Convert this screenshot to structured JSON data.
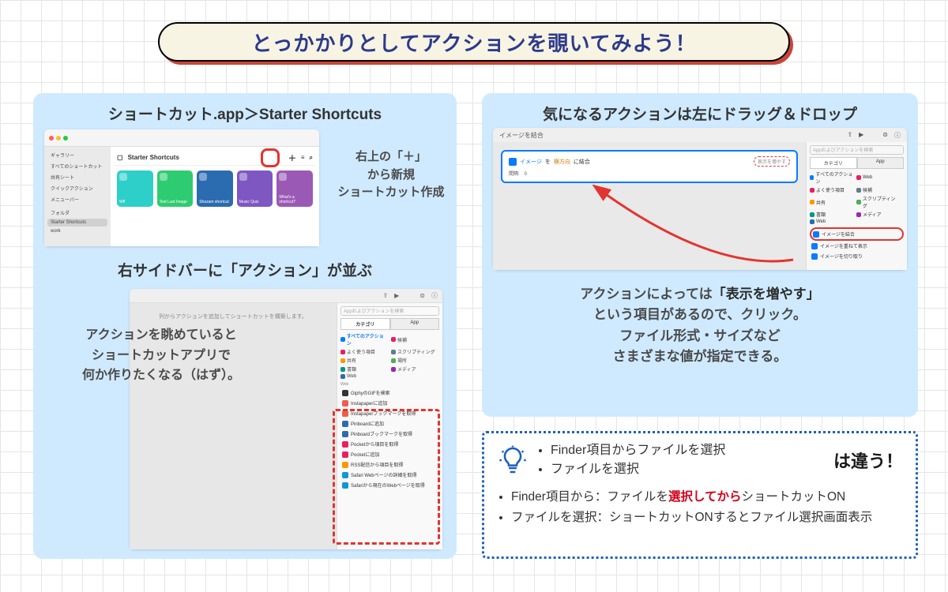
{
  "title": "とっかかりとしてアクションを覗いてみよう！",
  "left": {
    "heading": "ショートカット.app＞Starter Shortcuts",
    "starter": {
      "window_title": "Starter Shortcuts",
      "sidebar_group1": "ギャラリー",
      "sidebar_items": [
        "すべてのショートカット",
        "共有シート",
        "クイックアクション",
        "メニューバー"
      ],
      "sidebar_group2": "フォルダ",
      "sidebar_folders": [
        "Starter Shortcuts",
        "work"
      ],
      "tiles": [
        "Wfl",
        "Text Last Image",
        "Shazam shortcut",
        "Music Quiz",
        "What's a shortcut?"
      ]
    },
    "note1_l1": "右上の「＋」",
    "note1_l2": "から新規",
    "note1_l3": "ショートカット作成",
    "subheading2": "右サイドバーに「アクション」が並ぶ",
    "note2_l1": "アクションを眺めていると",
    "note2_l2": "ショートカットアプリで",
    "note2_l3": "何か作りたくなる（はず）。",
    "actions": {
      "hint": "列からアクションを追加してショートカットを構築します。",
      "tab1": "カテゴリ",
      "tab2": "App",
      "search": "Appおよびアクションを検索",
      "cats": [
        "すべてのアクション",
        "よく使う項目",
        "共有",
        "Web",
        "候補",
        "スクリプティング",
        "場所",
        "書類",
        "メディア"
      ],
      "group": "Web",
      "items": [
        {
          "c": "#333",
          "t": "GiphyのGIFを検索"
        },
        {
          "c": "#ec5f4a",
          "t": "Instapaperに追加"
        },
        {
          "c": "#ec5f4a",
          "t": "Instapaperブックマークを取得"
        },
        {
          "c": "#2b6cb0",
          "t": "Pinboardに追加"
        },
        {
          "c": "#2b6cb0",
          "t": "Pinboardブックマークを取得"
        },
        {
          "c": "#e91e63",
          "t": "Pocketから項目を取得"
        },
        {
          "c": "#e91e63",
          "t": "Pocketに追加"
        },
        {
          "c": "#ff9800",
          "t": "RSS配信から項目を取得"
        },
        {
          "c": "#1296db",
          "t": "Safari Webページの詳細を取得"
        },
        {
          "c": "#1296db",
          "t": "Safariから現在のWebページを取得"
        }
      ]
    }
  },
  "right": {
    "heading": "気になるアクションは左にドラッグ＆ドロップ",
    "editor": {
      "title": "イメージを結合",
      "step_pre": "イメージ",
      "step_mid": "を",
      "step_hi": "横方向",
      "step_post": "に結合",
      "expand": "表示を増やす",
      "row2": "間隔:　0",
      "search": "Appおよびアクションを検索",
      "tab1": "カテゴリ",
      "tab2": "App",
      "cats": [
        "すべてのアクション",
        "よく使う項目",
        "共有",
        "書類",
        "Web",
        "候補",
        "スクリプティング",
        "場所",
        "メディア"
      ],
      "acts": [
        "イメージを結合",
        "イメージを重ねて表示",
        "イメージを切り取り"
      ]
    },
    "note_l1_pre": "アクションによっては",
    "note_l1_b": "「表示を増やす」",
    "note_l2": "という項目があるので、クリック。",
    "note_l3": "ファイル形式・サイズなど",
    "note_l4": "さまざまな値が指定できる。"
  },
  "tip": {
    "b1": "Finder項目からファイルを選択",
    "b2": "ファイルを選択",
    "sfx": "は違う！",
    "d1_pre": "Finder項目から：ファイルを",
    "d1_em": "選択してから",
    "d1_post": "ショートカットON",
    "d2": "ファイルを選択：ショートカットONするとファイル選択画面表示"
  }
}
